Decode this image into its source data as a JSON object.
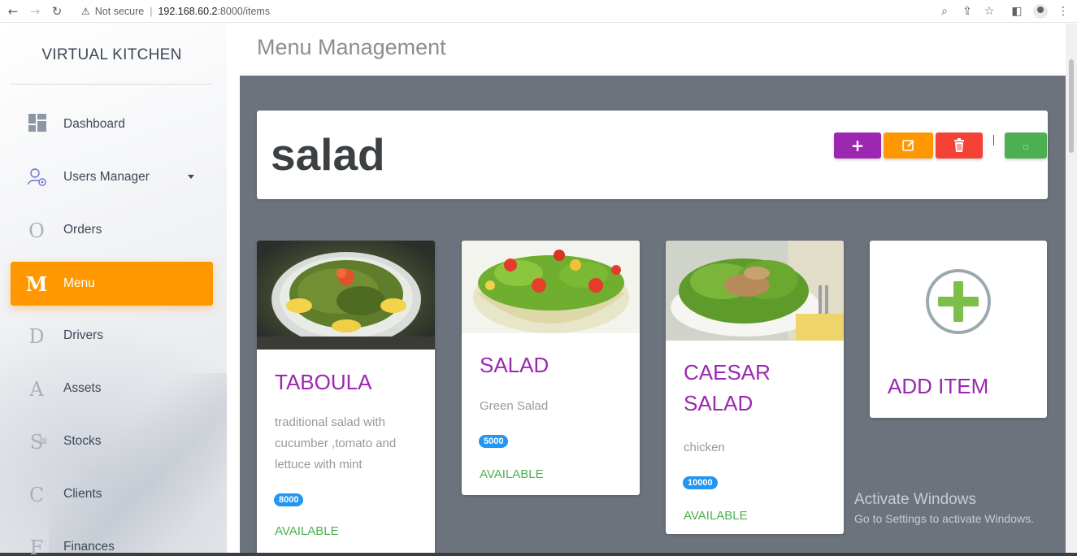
{
  "browser": {
    "security_label": "Not secure",
    "url_host": "192.168.60.2",
    "url_path": ":8000/items"
  },
  "sidebar": {
    "brand": "VIRTUAL KITCHEN",
    "items": [
      {
        "label": "Dashboard",
        "icon": "dashboard-icon"
      },
      {
        "label": "Users Manager",
        "icon": "users-manager-icon"
      },
      {
        "label": "Orders",
        "icon": "O"
      },
      {
        "label": "Menu",
        "icon": "M",
        "active": true
      },
      {
        "label": "Drivers",
        "icon": "D"
      },
      {
        "label": "Assets",
        "icon": "A"
      },
      {
        "label": "Stocks",
        "icon": "S"
      },
      {
        "label": "Clients",
        "icon": "C"
      },
      {
        "label": "Finances",
        "icon": "F"
      }
    ]
  },
  "page": {
    "title": "Menu Management",
    "category_title": "salad"
  },
  "actions": {
    "add": "+",
    "colors": {
      "add": "#9c27b0",
      "edit": "#ff9800",
      "delete": "#f44336",
      "green": "#4caf50"
    }
  },
  "items": [
    {
      "name": "TABOULA",
      "description": "traditional salad with cucumber ,tomato and lettuce with mint",
      "price": "8000",
      "status": "AVAILABLE"
    },
    {
      "name": "SALAD",
      "description": "Green Salad",
      "price": "5000",
      "status": "AVAILABLE"
    },
    {
      "name": "CAESAR SALAD",
      "description": "chicken",
      "price": "10000",
      "status": "AVAILABLE"
    }
  ],
  "add_item": {
    "label": "ADD ITEM"
  },
  "watermark": {
    "line1": "Activate Windows",
    "line2": "Go to Settings to activate Windows."
  },
  "colors": {
    "accent": "#ff9800",
    "item_name": "#9c27b0",
    "status": "#4caf50",
    "badge": "#2196f3"
  }
}
